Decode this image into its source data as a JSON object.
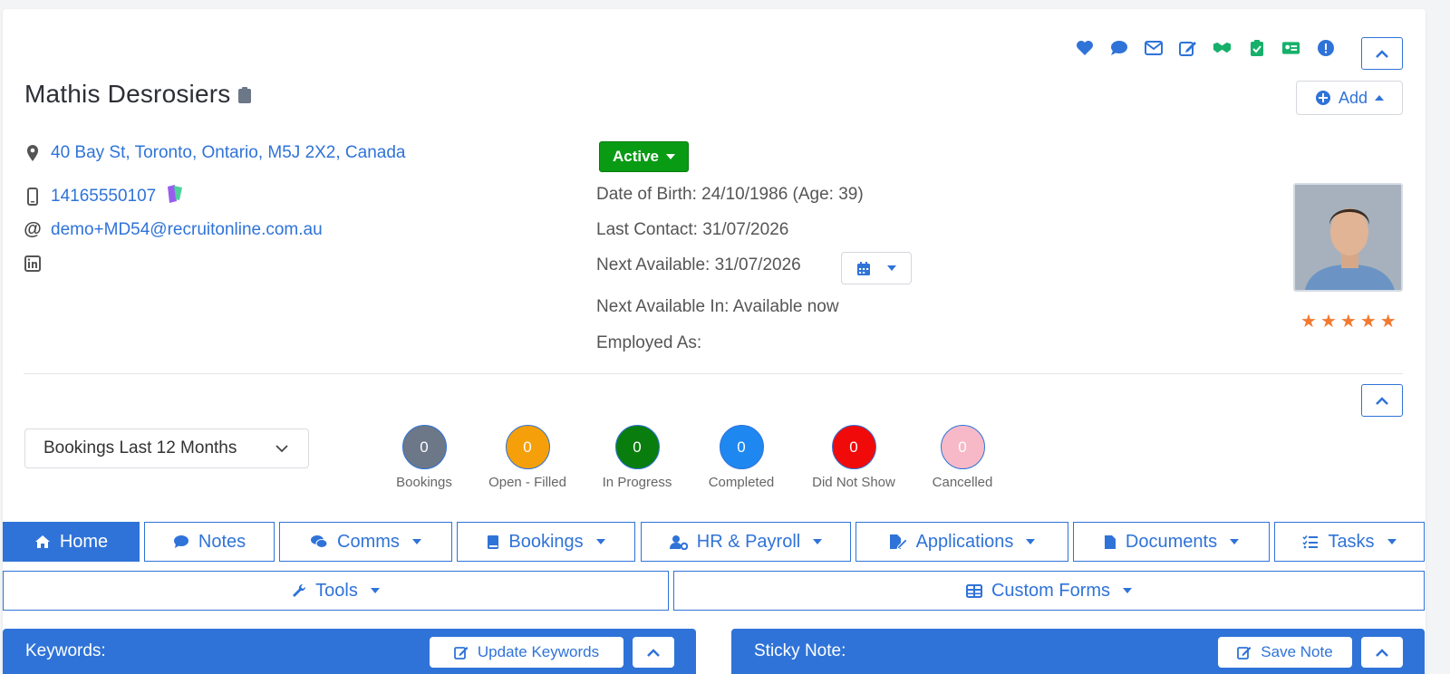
{
  "colors": {
    "accent": "#2f73d8",
    "active_status": "#0a9b14",
    "star": "#f27a30"
  },
  "header": {
    "icons": [
      "heart-icon",
      "chat-icon",
      "envelope-icon",
      "edit-icon",
      "handshake-icon",
      "clipboard-check-icon",
      "id-card-icon",
      "alert-icon"
    ],
    "name": "Mathis Desrosiers",
    "add_label": "Add"
  },
  "contact": {
    "address": "40 Bay St, Toronto, Ontario, M5J 2X2, Canada",
    "phone": "14165550107",
    "email": "demo+MD54@recruitonline.com.au"
  },
  "status": {
    "label": "Active"
  },
  "info": {
    "dob": "Date of Birth: 24/10/1986 (Age: 39)",
    "last_contact": "Last Contact: 31/07/2026",
    "next_available": "Next Available: 31/07/2026",
    "next_available_in": "Next Available In: Available now",
    "employed_as": "Employed As:"
  },
  "rating": {
    "stars": 5,
    "max": 5
  },
  "bookings": {
    "filter_label": "Bookings Last 12 Months",
    "stats": [
      {
        "label": "Bookings",
        "value": "0",
        "color": "#6c7788"
      },
      {
        "label": "Open - Filled",
        "value": "0",
        "color": "#f5a00a"
      },
      {
        "label": "In Progress",
        "value": "0",
        "color": "#0a7d0f"
      },
      {
        "label": "Completed",
        "value": "0",
        "color": "#1e88f0"
      },
      {
        "label": "Did Not Show",
        "value": "0",
        "color": "#f00a0a"
      },
      {
        "label": "Cancelled",
        "value": "0",
        "color": "#f7b9c8"
      }
    ]
  },
  "tabs": {
    "home": "Home",
    "notes": "Notes",
    "comms": "Comms",
    "bookings": "Bookings",
    "hr_payroll": "HR & Payroll",
    "applications": "Applications",
    "documents": "Documents",
    "tasks": "Tasks",
    "tools": "Tools",
    "custom_forms": "Custom Forms"
  },
  "panels": {
    "keywords": {
      "title": "Keywords:",
      "button": "Update Keywords"
    },
    "sticky": {
      "title": "Sticky Note:",
      "button": "Save Note"
    }
  }
}
